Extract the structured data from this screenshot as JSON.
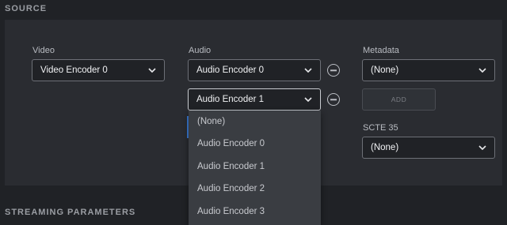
{
  "source": {
    "title": "SOURCE",
    "video": {
      "label": "Video",
      "value": "Video Encoder 0"
    },
    "audio": {
      "label": "Audio",
      "rows": [
        {
          "value": "Audio Encoder 0"
        },
        {
          "value": "Audio Encoder 1"
        }
      ],
      "dropdown_options": [
        "(None)",
        "Audio Encoder 0",
        "Audio Encoder 1",
        "Audio Encoder 2",
        "Audio Encoder 3"
      ]
    },
    "metadata": {
      "label": "Metadata",
      "value": "(None)",
      "add_label": "ADD"
    },
    "scte35": {
      "label": "SCTE 35",
      "value": "(None)"
    }
  },
  "streaming": {
    "title": "STREAMING PARAMETERS"
  },
  "colors": {
    "background": "#202226",
    "panel": "#2a2c31",
    "dropdown": "#3a3d42",
    "accent": "#3a7bd5"
  },
  "icons": [
    "chevron-down-icon",
    "minus-circle-icon"
  ]
}
